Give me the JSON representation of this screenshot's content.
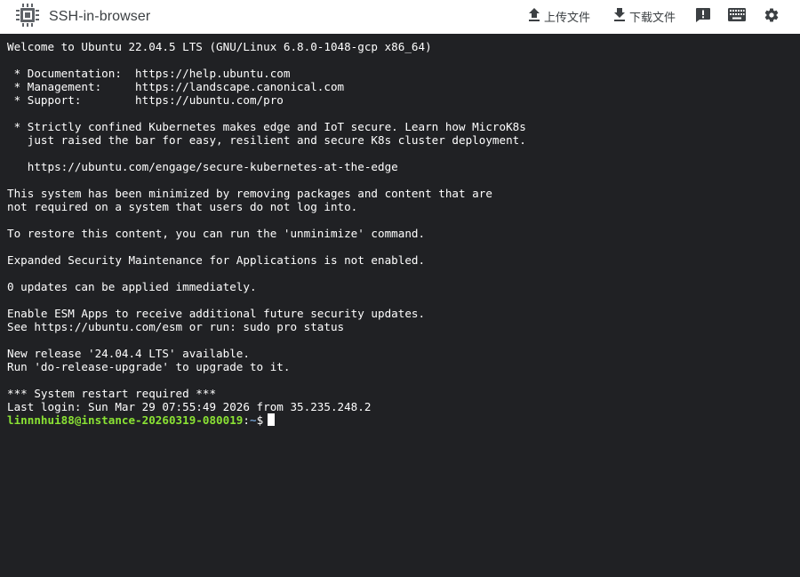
{
  "header": {
    "app_title": "SSH-in-browser",
    "logo_icon": "chip-icon",
    "upload_label": "上传文件",
    "download_label": "下载文件",
    "feedback_icon": "feedback-icon",
    "keyboard_icon": "keyboard-icon",
    "settings_icon": "gear-icon"
  },
  "terminal": {
    "lines": [
      "Welcome to Ubuntu 22.04.5 LTS (GNU/Linux 6.8.0-1048-gcp x86_64)",
      "",
      " * Documentation:  https://help.ubuntu.com",
      " * Management:     https://landscape.canonical.com",
      " * Support:        https://ubuntu.com/pro",
      "",
      " * Strictly confined Kubernetes makes edge and IoT secure. Learn how MicroK8s",
      "   just raised the bar for easy, resilient and secure K8s cluster deployment.",
      "",
      "   https://ubuntu.com/engage/secure-kubernetes-at-the-edge",
      "",
      "This system has been minimized by removing packages and content that are",
      "not required on a system that users do not log into.",
      "",
      "To restore this content, you can run the 'unminimize' command.",
      "",
      "Expanded Security Maintenance for Applications is not enabled.",
      "",
      "0 updates can be applied immediately.",
      "",
      "Enable ESM Apps to receive additional future security updates.",
      "See https://ubuntu.com/esm or run: sudo pro status",
      "",
      "New release '24.04.4 LTS' available.",
      "Run 'do-release-upgrade' to upgrade to it.",
      "",
      "*** System restart required ***",
      "Last login: Sun Mar 29 07:55:49 2026 from 35.235.248.2"
    ],
    "prompt": {
      "user_host": "linnnhui88@instance-20260319-080019",
      "separator": ":",
      "path": "~",
      "symbol": "$"
    }
  }
}
